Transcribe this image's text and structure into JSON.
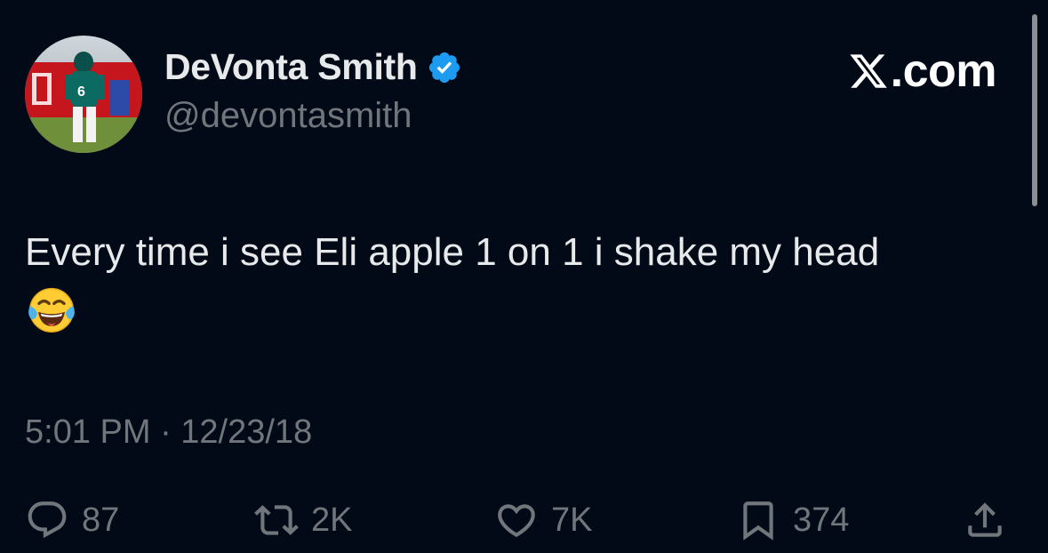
{
  "author": {
    "display_name": "DeVonta Smith",
    "handle": "@devontasmith",
    "verified": true,
    "avatar_jersey_number": "6"
  },
  "brand": {
    "text": ".com",
    "icon": "x-logo-icon"
  },
  "tweet": {
    "text": "Every time i see Eli apple 1 on 1 i shake my head",
    "emoji": "😂",
    "emoji_icon": "face-with-tears-of-joy-icon",
    "timestamp": "5:01 PM · 12/23/18"
  },
  "actions": {
    "replies": "87",
    "reposts": "2K",
    "likes": "7K",
    "bookmarks": "374"
  },
  "colors": {
    "background": "#020a18",
    "primary_text": "#e7e9ea",
    "secondary_text": "#71767b",
    "verified_blue": "#1d9bf0"
  }
}
